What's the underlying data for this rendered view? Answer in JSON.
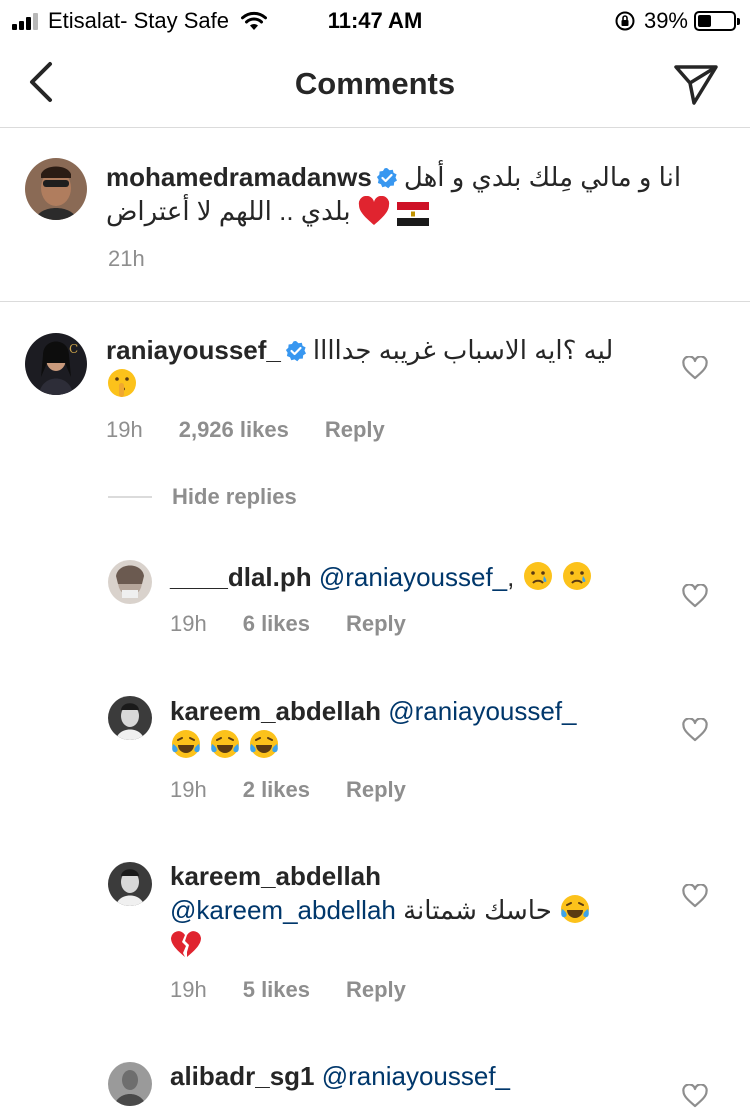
{
  "status_bar": {
    "carrier": "Etisalat- Stay Safe",
    "time": "11:47 AM",
    "battery": "39%",
    "battery_level": 0.39,
    "icons": [
      "signal-icon",
      "wifi-icon",
      "orientation-lock-icon",
      "battery-icon"
    ]
  },
  "header": {
    "title": "Comments",
    "back_icon": "chevron-left-icon",
    "send_icon": "paper-plane-icon"
  },
  "caption": {
    "username": "mohamedramadanws",
    "verified": true,
    "line1": "انا و مالي مِلك بلدي و أهل",
    "line2": "بلدي .. اللهم لا أعتراض",
    "emojis": [
      "red-heart",
      "egypt-flag"
    ],
    "time": "21h"
  },
  "comments": [
    {
      "username": "raniayoussef_",
      "verified": true,
      "text": "ليه ؟ايه الاسباب غريبه جداااا",
      "emojis": [
        "shushing-face"
      ],
      "time": "19h",
      "likes": "2,926 likes",
      "reply": "Reply"
    }
  ],
  "hide_replies": "Hide replies",
  "replies": [
    {
      "username": "____dlal.ph",
      "mention": "@raniayoussef_",
      "suffix": ",",
      "emojis": [
        "crying-face",
        "crying-face"
      ],
      "time": "19h",
      "likes": "6 likes",
      "reply": "Reply"
    },
    {
      "username": "kareem_abdellah",
      "mention": "@raniayoussef_",
      "emojis": [
        "tears-of-joy",
        "tears-of-joy",
        "tears-of-joy"
      ],
      "time": "19h",
      "likes": "2 likes",
      "reply": "Reply"
    },
    {
      "username": "kareem_abdellah",
      "mention": "@kareem_abdellah",
      "text": "حاسك شمتانة",
      "emojis": [
        "tears-of-joy",
        "broken-heart"
      ],
      "time": "19h",
      "likes": "5 likes",
      "reply": "Reply"
    },
    {
      "username": "alibadr_sg1",
      "mention": "@raniayoussef_"
    }
  ],
  "colors": {
    "text": "#262626",
    "secondary": "#8e8e8e",
    "mention": "#00376b",
    "verified": "#3897f0",
    "divider": "#dbdbdb"
  }
}
